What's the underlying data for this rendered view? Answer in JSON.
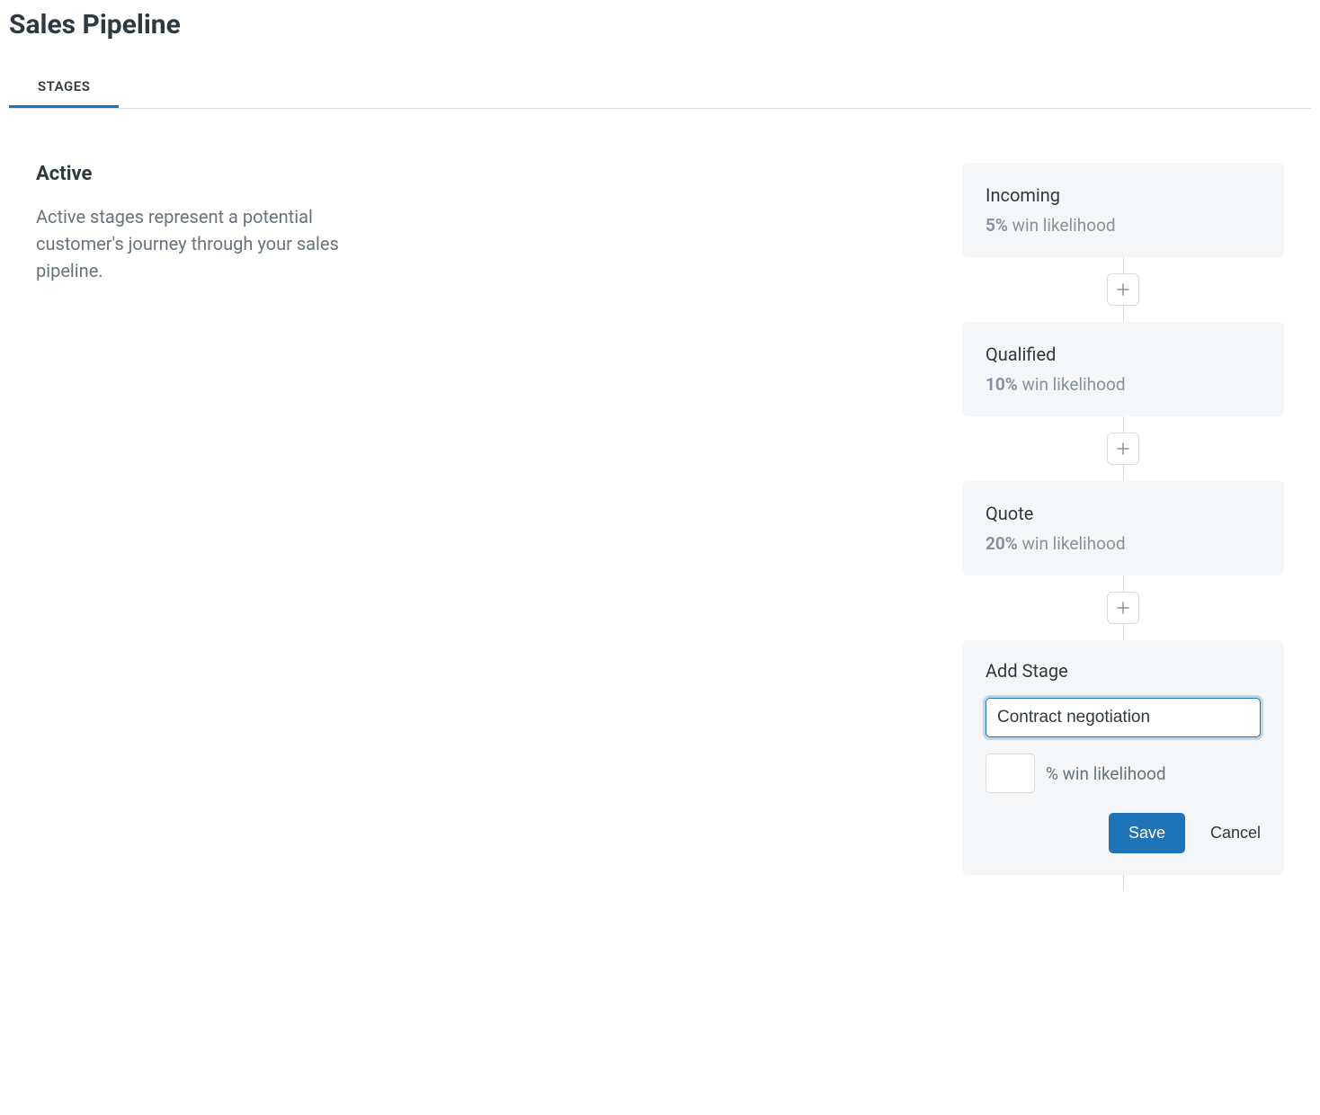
{
  "header": {
    "title": "Sales Pipeline"
  },
  "tabs": {
    "stages": "STAGES"
  },
  "sidebar": {
    "heading": "Active",
    "description": "Active stages represent a potential customer's journey through your sales pipeline."
  },
  "common": {
    "win_likelihood_label": "win likelihood",
    "pct_win_likelihood_label": "% win likelihood"
  },
  "stages": [
    {
      "name": "Incoming",
      "win_pct": "5%"
    },
    {
      "name": "Qualified",
      "win_pct": "10%"
    },
    {
      "name": "Quote",
      "win_pct": "20%"
    }
  ],
  "add_stage": {
    "title": "Add Stage",
    "name_value": "Contract negotiation",
    "pct_value": "",
    "save_label": "Save",
    "cancel_label": "Cancel"
  }
}
